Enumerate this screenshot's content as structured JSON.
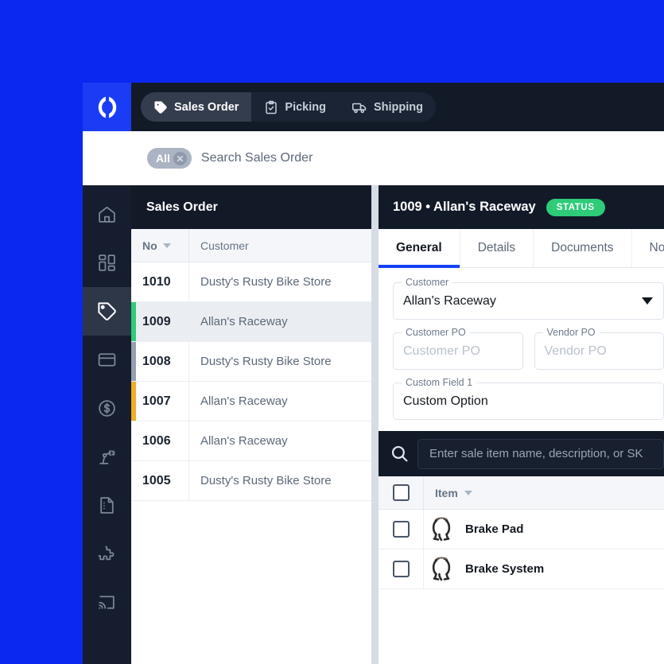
{
  "colors": {
    "page_background": "#0a28f0",
    "logo_tile": "#1b3cf5",
    "header_dark": "#121a28",
    "sidebar_dark": "#151d2e",
    "sidebar_active": "#2d3748",
    "accent_blue": "#1542f5",
    "status_green": "#2ecc78",
    "flag_green": "#2ecc78",
    "flag_gray": "#96a1b0",
    "flag_amber": "#f0ad29"
  },
  "topbar": {
    "logo_name": "app-logo",
    "tabs": [
      {
        "label": "Sales Order",
        "icon": "tag-icon",
        "active": true
      },
      {
        "label": "Picking",
        "icon": "clipboard-check-icon",
        "active": false
      },
      {
        "label": "Shipping",
        "icon": "truck-icon",
        "active": false
      }
    ]
  },
  "search": {
    "chip_label": "All",
    "placeholder": "Search Sales Order"
  },
  "sidebar": {
    "items": [
      {
        "name": "sidebar-item-home",
        "icon": "home-icon",
        "active": false
      },
      {
        "name": "sidebar-item-dashboard",
        "icon": "dashboard-grid-icon",
        "active": false
      },
      {
        "name": "sidebar-item-sales",
        "icon": "tag-icon",
        "active": true
      },
      {
        "name": "sidebar-item-payments",
        "icon": "credit-card-icon",
        "active": false
      },
      {
        "name": "sidebar-item-finance",
        "icon": "dollar-circle-icon",
        "active": false
      },
      {
        "name": "sidebar-item-production",
        "icon": "robot-arm-icon",
        "active": false
      },
      {
        "name": "sidebar-item-documents",
        "icon": "document-icon",
        "active": false
      },
      {
        "name": "sidebar-item-integrations",
        "icon": "puzzle-icon",
        "active": false
      },
      {
        "name": "sidebar-item-cast",
        "icon": "cast-icon",
        "active": false
      }
    ]
  },
  "list_pane": {
    "title": "Sales Order",
    "columns": [
      "No",
      "Customer"
    ],
    "rows": [
      {
        "no": "1010",
        "customer": "Dusty's Rusty Bike Store",
        "flag": "none",
        "selected": false
      },
      {
        "no": "1009",
        "customer": "Allan's Raceway",
        "flag": "green",
        "selected": true
      },
      {
        "no": "1008",
        "customer": "Dusty's Rusty Bike Store",
        "flag": "gray",
        "selected": false
      },
      {
        "no": "1007",
        "customer": "Allan's Raceway",
        "flag": "amber",
        "selected": false
      },
      {
        "no": "1006",
        "customer": "Allan's Raceway",
        "flag": "none",
        "selected": false
      },
      {
        "no": "1005",
        "customer": "Dusty's Rusty Bike Store",
        "flag": "none",
        "selected": false
      }
    ]
  },
  "detail_pane": {
    "header_title": "1009 • Allan's Raceway",
    "status_badge": "STATUS",
    "tabs": [
      {
        "label": "General",
        "active": true
      },
      {
        "label": "Details",
        "active": false
      },
      {
        "label": "Documents",
        "active": false
      },
      {
        "label": "Notes",
        "active": false
      }
    ],
    "form": {
      "customer": {
        "label": "Customer",
        "value": "Allan's Raceway"
      },
      "customer_po": {
        "label": "Customer PO",
        "placeholder": "Customer PO"
      },
      "vendor_po": {
        "label": "Vendor PO",
        "placeholder": "Vendor PO"
      },
      "custom_field_1": {
        "label": "Custom Field 1",
        "value": "Custom Option"
      }
    },
    "item_search": {
      "placeholder": "Enter sale item name, description, or SK",
      "icon": "search-icon"
    },
    "items_table": {
      "columns": [
        "Item"
      ],
      "rows": [
        {
          "name": "Brake Pad",
          "thumb": "brake-caliper-thumbnail",
          "checked": false
        },
        {
          "name": "Brake System",
          "thumb": "brake-caliper-thumbnail",
          "checked": false
        }
      ]
    }
  }
}
